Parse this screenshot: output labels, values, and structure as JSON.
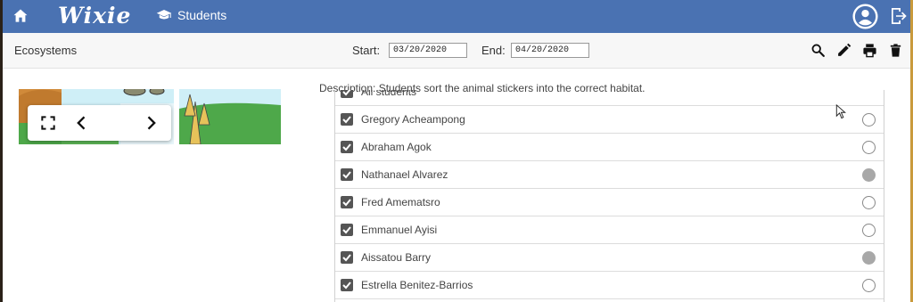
{
  "header": {
    "logo": "Wixie",
    "tab_label": "Students",
    "icons": [
      "home-icon",
      "graduation-cap-icon",
      "account-icon",
      "logout-icon"
    ]
  },
  "toolbar": {
    "title": "Ecosystems",
    "start_label": "Start:",
    "start_value": "03/20/2020",
    "end_label": "End:",
    "end_value": "04/20/2020",
    "icons": [
      "search-icon",
      "edit-icon",
      "print-icon",
      "delete-icon"
    ]
  },
  "description": "Description:  Students sort the animal stickers into the correct habitat.",
  "list_partial_label": "All students",
  "students": [
    {
      "name": "Gregory Acheampong",
      "checked": true,
      "selected": false
    },
    {
      "name": "Abraham Agok",
      "checked": true,
      "selected": false
    },
    {
      "name": "Nathanael Alvarez",
      "checked": true,
      "selected": true
    },
    {
      "name": "Fred Amematsro",
      "checked": true,
      "selected": false
    },
    {
      "name": "Emmanuel Ayisi",
      "checked": true,
      "selected": false
    },
    {
      "name": "Aissatou Barry",
      "checked": true,
      "selected": true
    },
    {
      "name": "Estrella Benitez-Barrios",
      "checked": true,
      "selected": false
    }
  ],
  "colors": {
    "header": "#4a72b2",
    "toolbar": "#f7f7f7",
    "radio_selected": "#a8a8a8"
  }
}
